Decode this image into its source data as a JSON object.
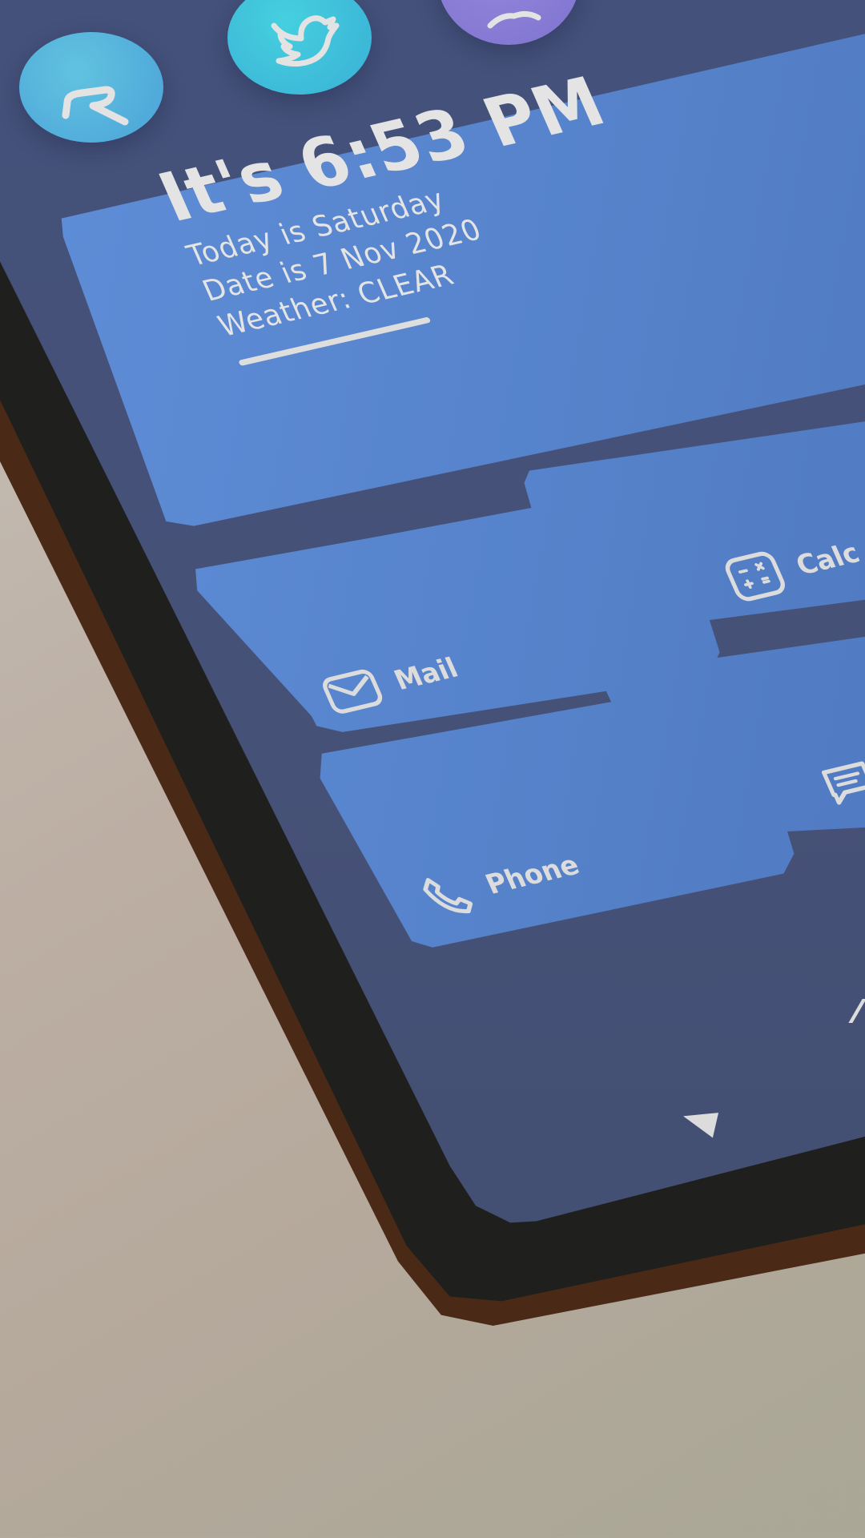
{
  "clock_widget": {
    "title": "It's 6:53 PM",
    "day_line": "Today is Saturday",
    "date_line": "Date is 7 Nov 2020",
    "weather_line": "Weather: CLEAR"
  },
  "app_tiles": [
    {
      "label": "Mail",
      "icon": "mail-icon"
    },
    {
      "label": "Phone",
      "icon": "phone-icon"
    },
    {
      "label": "Calc",
      "icon": "calculator-icon"
    },
    {
      "label": "",
      "icon": "message-icon"
    }
  ],
  "social_shortcuts": [
    {
      "icon": "rf-logo-icon",
      "color": "#4fb0dc"
    },
    {
      "icon": "twitter-icon",
      "color": "#3fc4dc"
    },
    {
      "icon": "discord-icon",
      "color": "#8a7cd4"
    }
  ],
  "nav_bar": {
    "back_icon": "back-triangle-icon",
    "home_icon": "home-icon"
  },
  "colors": {
    "screen_bg": "#44517a",
    "tile_bg": "#5683cb",
    "text": "#e4e4e4",
    "frame": "#1f1f1d",
    "frame_edge": "#4a2a16"
  }
}
